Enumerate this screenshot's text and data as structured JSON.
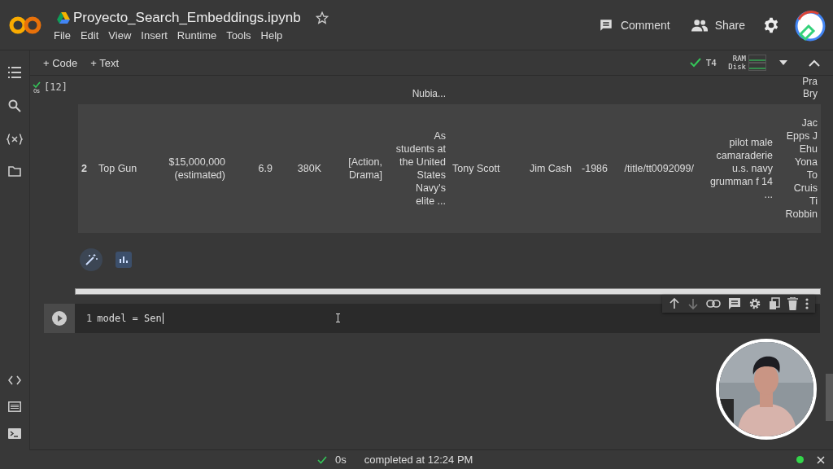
{
  "header": {
    "title": "Proyecto_Search_Embeddings.ipynb",
    "menu": [
      "File",
      "Edit",
      "View",
      "Insert",
      "Runtime",
      "Tools",
      "Help"
    ],
    "comment": "Comment",
    "share": "Share"
  },
  "toolbar": {
    "add": [
      "+ Code",
      "+ Text"
    ],
    "runtime": "T4",
    "connected": true,
    "resources": [
      "RAM",
      "Disk"
    ]
  },
  "output_cell": {
    "done": true,
    "time": "0s",
    "count": "[12]",
    "partial_row": {
      "description": "Nubia...",
      "cast": "Pra\nBry"
    },
    "row": [
      "2",
      "Top Gun",
      "$15,000,000\n(estimated)",
      "6.9",
      "380K",
      "[Action,\nDrama]",
      "As\nstudents at\nthe United\nStates\nNavy's\nelite ...",
      "Tony Scott",
      "Jim Cash",
      "-1986",
      "/title/tt0092099/",
      "pilot male\ncamaraderie\nu.s. navy\ngrumman f 14\n...",
      "Jac\nEpps J\nEhu\nYona\nTo\nCruis\nTi\nRobbin"
    ]
  },
  "code_cell": {
    "line": "1",
    "code": "model = Sen"
  },
  "status_bar": {
    "done": true,
    "time": "0s",
    "message": "completed at 12:24 PM",
    "connected": true
  }
}
